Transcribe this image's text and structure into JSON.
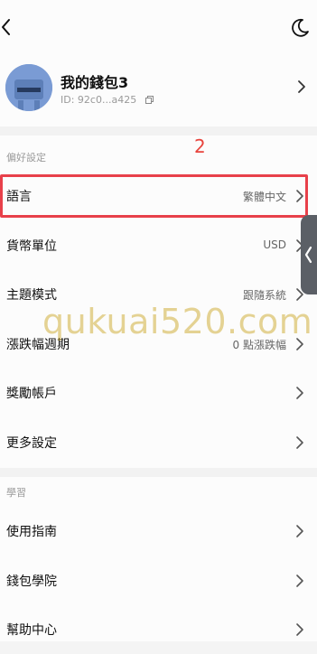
{
  "wallet": {
    "name": "我的錢包3",
    "id": "ID: 92c0...a425"
  },
  "sections": {
    "preferences": "偏好設定",
    "learning": "學習"
  },
  "annotation": {
    "step": "2"
  },
  "preference_rows": [
    {
      "label": "語言",
      "value": "繁體中文"
    },
    {
      "label": "貨幣單位",
      "value": "USD"
    },
    {
      "label": "主題模式",
      "value": "跟隨系統"
    },
    {
      "label": "漲跌幅週期",
      "value": "0 點漲跌幅"
    },
    {
      "label": "獎勵帳戶",
      "value": ""
    },
    {
      "label": "更多設定",
      "value": ""
    }
  ],
  "learning_rows": [
    {
      "label": "使用指南"
    },
    {
      "label": "錢包學院"
    },
    {
      "label": "幫助中心"
    }
  ],
  "watermark": "qukuai520.com",
  "icons": {
    "back": "chevron-left-icon",
    "theme": "moon-icon",
    "copy": "copy-icon",
    "chevron": "chevron-right-icon",
    "side_handle": "chevron-left-icon"
  },
  "colors": {
    "highlight": "#e8404a",
    "step_label": "#e8433c",
    "avatar": "#7a9bd4"
  }
}
